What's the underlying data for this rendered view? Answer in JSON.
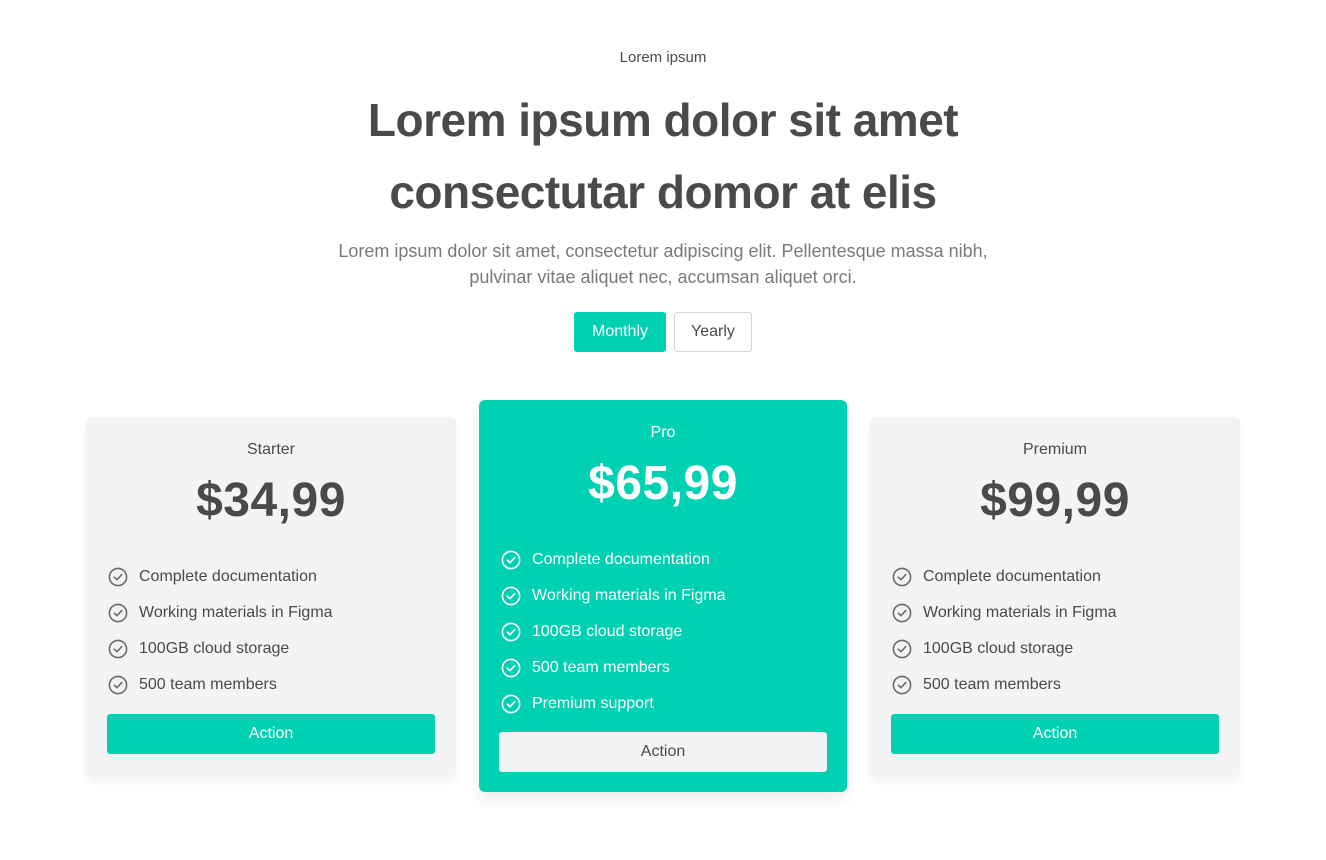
{
  "header": {
    "eyebrow": "Lorem ipsum",
    "title_line1": "Lorem ipsum dolor sit amet",
    "title_line2": "consectutar domor at elis",
    "subtitle_line1": "Lorem ipsum dolor sit amet, consectetur adipiscing elit. Pellentesque massa nibh,",
    "subtitle_line2": "pulvinar vitae aliquet nec, accumsan aliquet orci."
  },
  "billing_toggle": {
    "monthly": "Monthly",
    "yearly": "Yearly",
    "selected": "Monthly"
  },
  "plans": [
    {
      "name": "Starter",
      "price": "$34,99",
      "features": [
        "Complete documentation",
        "Working materials in Figma",
        "100GB cloud storage",
        "500 team members"
      ],
      "action": "Action",
      "featured": false
    },
    {
      "name": "Pro",
      "price": "$65,99",
      "features": [
        "Complete documentation",
        "Working materials in Figma",
        "100GB cloud storage",
        "500 team members",
        "Premium support"
      ],
      "action": "Action",
      "featured": true
    },
    {
      "name": "Premium",
      "price": "$99,99",
      "features": [
        "Complete documentation",
        "Working materials in Figma",
        "100GB cloud storage",
        "500 team members"
      ],
      "action": "Action",
      "featured": false
    }
  ],
  "icons": {
    "feature": "check-circle-icon"
  },
  "colors": {
    "accent": "#00d1b2",
    "text": "#4a4a4a",
    "muted": "#7a7a7a",
    "card_bg": "#f4f4f4"
  }
}
